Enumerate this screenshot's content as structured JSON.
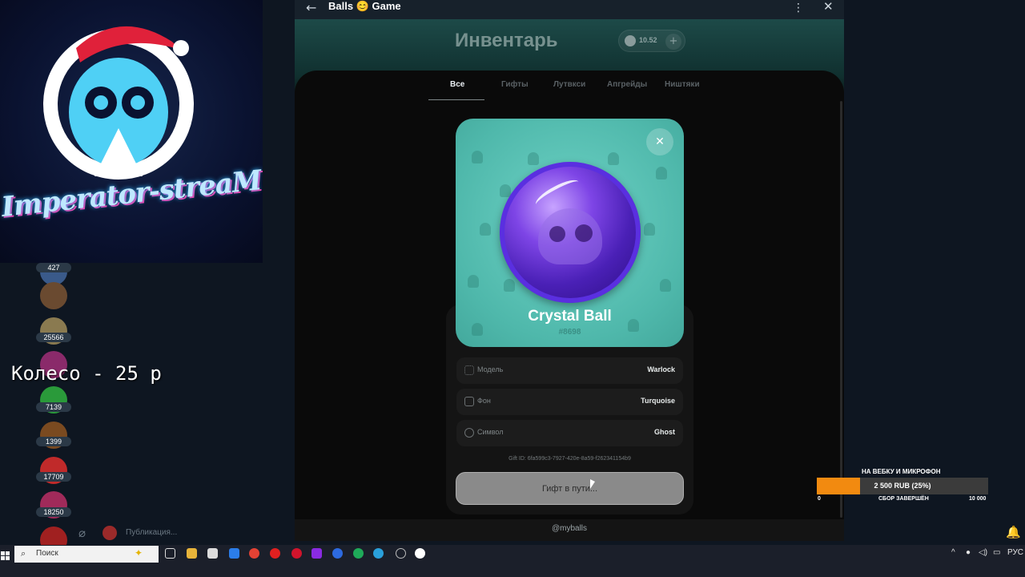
{
  "window": {
    "title": "Balls 😊 Game"
  },
  "app": {
    "title": "Инвентарь",
    "balance": "10.52",
    "tabs": [
      "Все",
      "Гифты",
      "Лутвкси",
      "Апгрейды",
      "Ништяки"
    ],
    "active_tab": "Все",
    "footer_handle": "@myballs"
  },
  "gift": {
    "name": "Crystal Ball",
    "number": "#8698",
    "attributes": [
      {
        "label": "Модель",
        "value": "Warlock",
        "icon": "model-icon"
      },
      {
        "label": "Фон",
        "value": "Turquoise",
        "icon": "backdrop-icon"
      },
      {
        "label": "Символ",
        "value": "Ghost",
        "icon": "symbol-icon"
      }
    ],
    "gift_id": "Gift ID: 6fa599c3-7927-420e-8a59-f262341154b9",
    "action_label": "Гифт в пути..."
  },
  "stream": {
    "brand": "Imperator-streaM",
    "overlay_text": "Колесо - 25 р",
    "goal": {
      "title": "НА ВЕБКУ И МИКРОФОН",
      "amount_label": "2 500 RUB (25%)",
      "progress": 0.25,
      "min": "0",
      "status": "СБОР ЗАВЕРШЁН",
      "max": "10 000",
      "fill_color": "#f28a10"
    }
  },
  "chat_rail": {
    "counts": [
      "427",
      "25566",
      "7139",
      "1399",
      "17709",
      "18250"
    ]
  },
  "compose": {
    "placeholder": "Публикация..."
  },
  "taskbar": {
    "search_placeholder": "Поиск",
    "language": "РУС"
  },
  "colors": {
    "accent": "#4fb8ab",
    "orb": "#6a34e0"
  }
}
